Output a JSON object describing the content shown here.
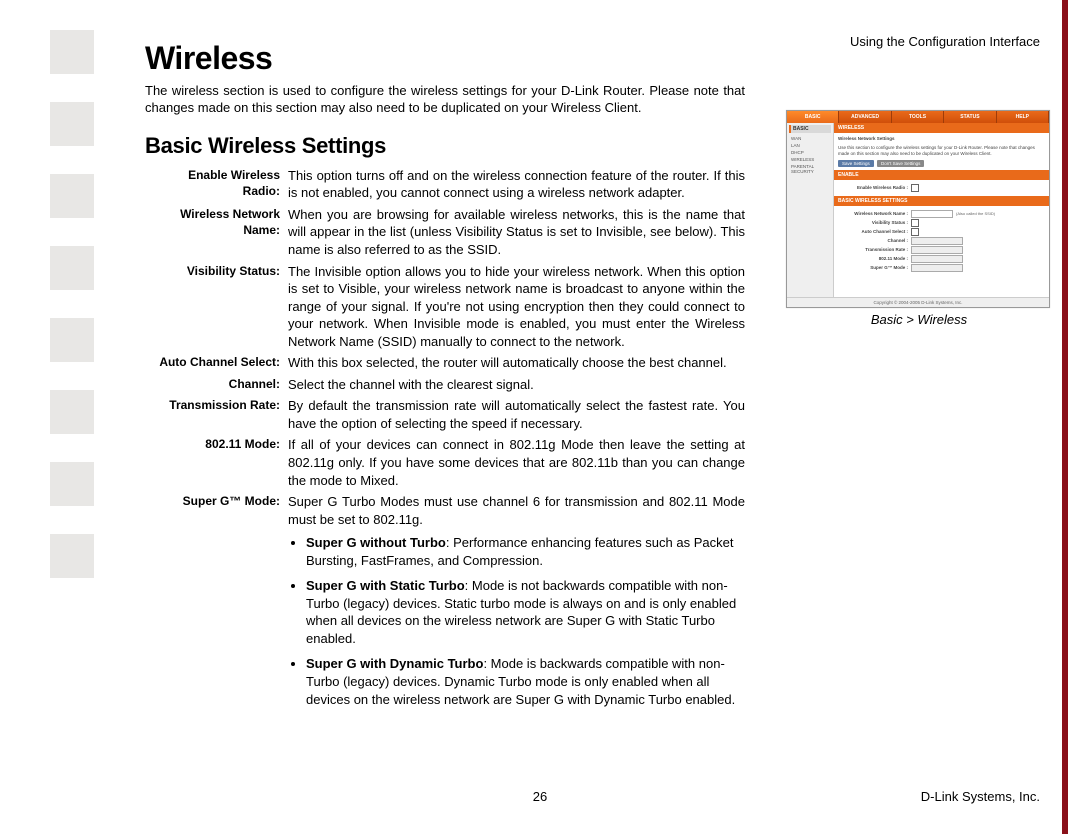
{
  "header_right": "Using the Configuration Interface",
  "title": "Wireless",
  "intro": "The wireless section is used to configure the wireless settings for your D-Link Router. Please note that changes made on this section may also need to be duplicated on your Wireless Client.",
  "subtitle": "Basic Wireless Settings",
  "settings": {
    "enable_radio": {
      "term_a": "Enable Wireless",
      "term_b": "Radio:",
      "desc": "This option turns off and on the wireless connection feature of the router. If this is not enabled, you cannot connect using a wireless network adapter."
    },
    "net_name": {
      "term_a": "Wireless Network",
      "term_b": "Name:",
      "desc": "When you are browsing for available wireless networks, this is the name that will appear in the list (unless Visibility Status is set to Invisible, see below). This name is also referred to as the SSID."
    },
    "visibility": {
      "term": "Visibility Status:",
      "desc": "The Invisible option allows you to hide your wireless network. When this option is set to Visible, your wireless network name is broadcast to anyone within the range of your signal. If you're not using encryption then they could connect to your network. When Invisible mode is enabled, you must enter the Wireless Network Name (SSID) manually to connect to the network."
    },
    "auto_channel": {
      "term": "Auto Channel Select:",
      "desc": "With this box selected, the router will automatically choose the best channel."
    },
    "channel": {
      "term": "Channel:",
      "desc": "Select the channel with the clearest signal."
    },
    "tx_rate": {
      "term": "Transmission Rate:",
      "desc": "By default the transmission rate will automatically select the fastest rate. You have the option of selecting the speed if necessary."
    },
    "mode80211": {
      "term": "802.11 Mode:",
      "desc": "If all of your devices can connect in 802.11g Mode then leave the setting at 802.11g only. If you have some devices that are 802.11b than you can change the mode to Mixed."
    },
    "superg": {
      "term": "Super G™ Mode:",
      "desc": "Super G Turbo Modes must use channel 6 for transmission and 802.11 Mode must be set to 802.11g.",
      "bullets": [
        {
          "b": "Super G without Turbo",
          "t": ": Performance enhancing features such as Packet Bursting, FastFrames, and Compression."
        },
        {
          "b": "Super G with Static Turbo",
          "t": ": Mode is not backwards compatible with non-Turbo (legacy) devices. Static turbo mode is always on and is only enabled when all devices on the wireless network are Super G with Static Turbo enabled."
        },
        {
          "b": "Super G with Dynamic Turbo",
          "t": ": Mode is backwards compatible with non-Turbo (legacy) devices. Dynamic Turbo mode is only enabled when all devices on the wireless network are Super G with Dynamic Turbo enabled."
        }
      ]
    }
  },
  "screenshot": {
    "tabs": [
      "BASIC",
      "ADVANCED",
      "TOOLS",
      "STATUS",
      "HELP"
    ],
    "side_head": "BASIC",
    "side_items": [
      "WAN",
      "LAN",
      "DHCP",
      "WIRELESS",
      "PARENTAL SECURITY"
    ],
    "bar1": "WIRELESS",
    "panel1_title": "Wireless Network Settings",
    "panel1_text": "Use this section to configure the wireless settings for your D-Link Router. Please note that changes made on this section may also need to be duplicated on your Wireless Client.",
    "btn_save": "Save Settings",
    "btn_dont": "Don't Save Settings",
    "bar2": "ENABLE",
    "f_enable": "Enable Wireless Radio :",
    "bar3": "BASIC WIRELESS SETTINGS",
    "f_name": "Wireless Network Name :",
    "f_name_side": "(Also called the SSID)",
    "f_vis": "Visibility Status :",
    "f_auto": "Auto Channel Select :",
    "f_chan": "Channel :",
    "f_tx": "Transmission Rate :",
    "f_802": "802.11 Mode :",
    "f_sg": "Super G™ Mode :",
    "copyright": "Copyright © 2004-2005 D-Link Systems, Inc."
  },
  "caption": "Basic > Wireless",
  "page_number": "26",
  "footer_right": "D-Link Systems, Inc."
}
